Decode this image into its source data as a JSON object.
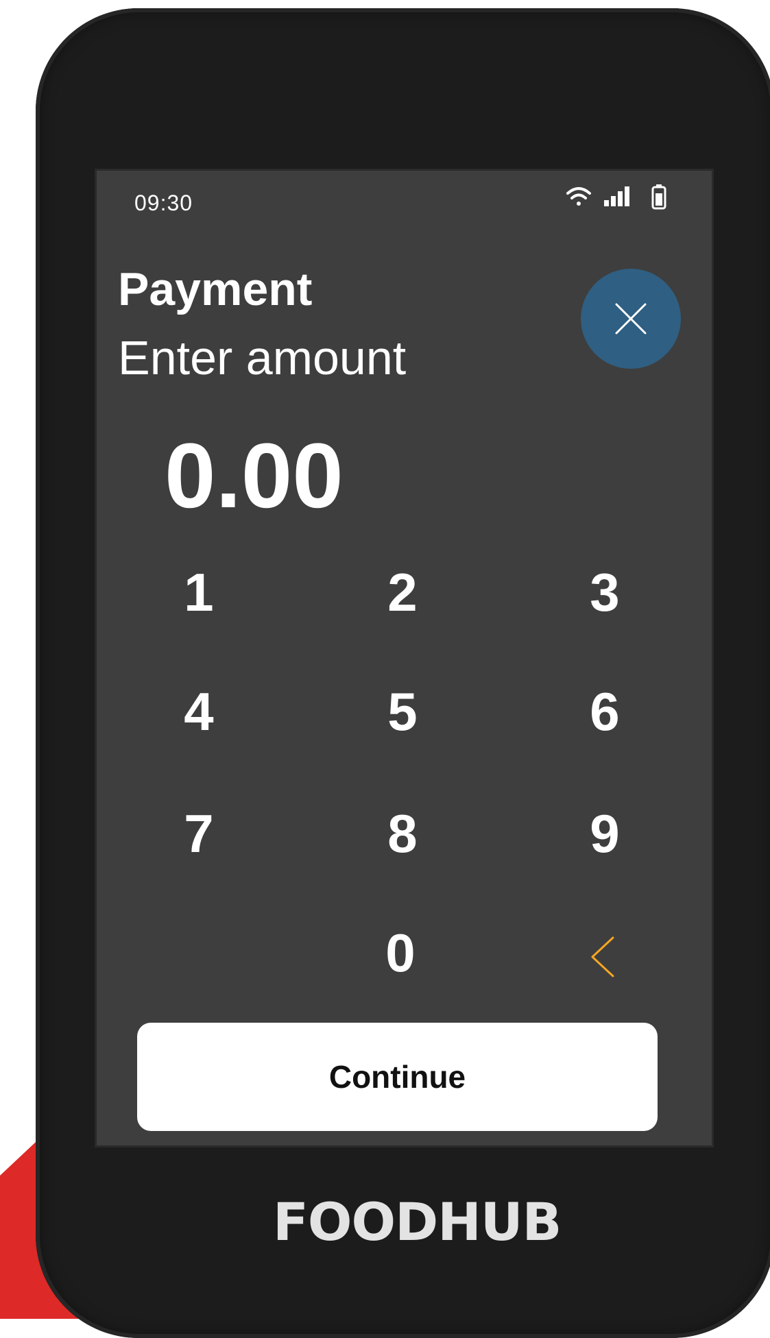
{
  "status_bar": {
    "time": "09:30",
    "icons": [
      "wifi-icon",
      "signal-icon",
      "battery-icon"
    ]
  },
  "header": {
    "title": "Payment",
    "subtitle": "Enter amount"
  },
  "close_button": {
    "icon": "close-icon",
    "color": "#2f5f82"
  },
  "amount": {
    "value": "0.00"
  },
  "keypad": {
    "keys": [
      "1",
      "2",
      "3",
      "4",
      "5",
      "6",
      "7",
      "8",
      "9",
      "0"
    ],
    "backspace_icon": "chevron-left-icon",
    "backspace_color": "#f5a623"
  },
  "continue_button": {
    "label": "Continue"
  },
  "brand": {
    "logo_text": "FOODHUB"
  },
  "colors": {
    "accent_red": "#dd2a28",
    "device_body": "#1c1c1c",
    "screen_background": "#3e3e3e"
  }
}
